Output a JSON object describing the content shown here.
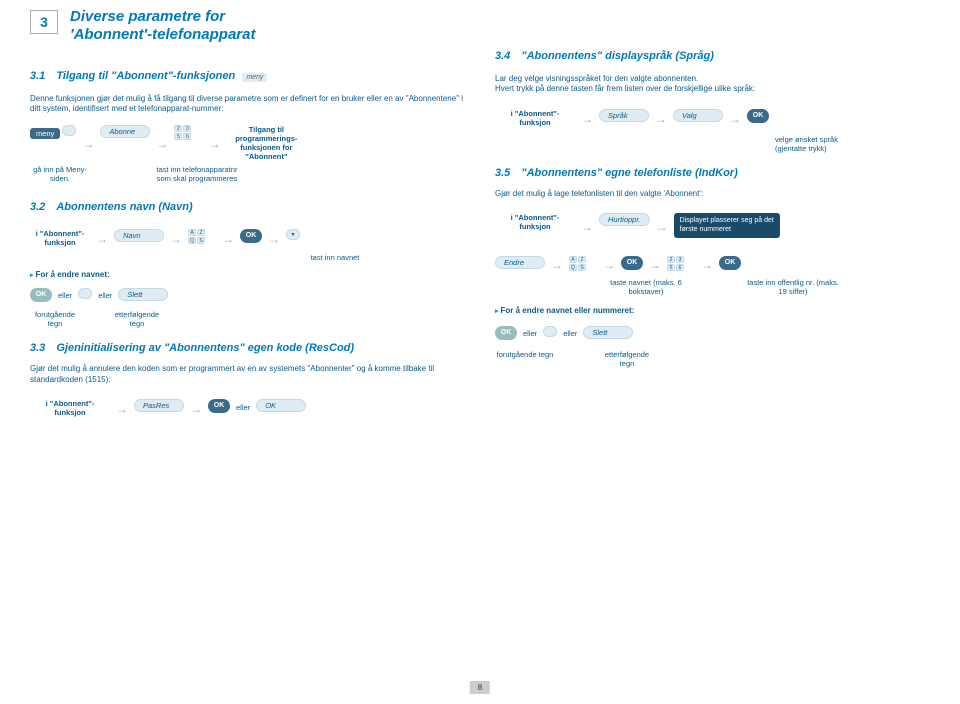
{
  "page_number": "3",
  "page_title_line1": "Diverse parametre for",
  "page_title_line2": "'Abonnent'-telefonapparat",
  "sec31": {
    "num": "3.1",
    "title": "Tilgang til \"Abonnent\"-funksjonen",
    "tag": "meny",
    "intro": "Denne funksjonen gjør det mulig å få tilgang til diverse parametre som er definert for en bruker eller en av \"Abonnentene\" i ditt system, identifisert med et telefonapparat-nummer:",
    "meny_label": "meny",
    "abonne_pill": "Abonne",
    "cap1": "gå inn på Meny-siden.",
    "cap2": "tast inn telefonapparatnr som skal programmeres",
    "cap3": "Tilgang til programmerings-funksjonen for \"Abonnent\""
  },
  "sec32": {
    "num": "3.2",
    "title": "Abonnentens navn (Navn)",
    "abonnent_func": "i \"Abonnent\"-funksjon",
    "navn_pill": "Navn",
    "ok": "OK",
    "cap_tast": "tast inn navnet",
    "endre": "For å endre navnet:",
    "eller": "eller",
    "slett_pill": "Slett",
    "cap_forut": "forutgående tegn",
    "cap_etter": "etterfølgende tegn"
  },
  "sec33": {
    "num": "3.3",
    "title": "Gjeninitialisering av \"Abonnentens\" egen kode (ResCod)",
    "intro": "Gjør det mulig å annulere den koden som er programmert av en av systemets \"Abonnenter\" og å komme tilbake til standardkoden (1515):",
    "abonnent_func": "i \"Abonnent\"-funksjon",
    "pasres_pill": "PasRes",
    "ok": "OK",
    "eller": "eller",
    "ok_pill": "OK"
  },
  "sec34": {
    "num": "3.4",
    "title": "\"Abonnentens\" displayspråk (Språg)",
    "line1": "Lar deg velge visningsspråket for den valgte abonnenten.",
    "line2": "Hvert trykk på denne tasten får frem listen over de forskjellige ulike språk:",
    "abonnent_func": "i \"Abonnent\"-funksjon",
    "sprak_pill": "Språk",
    "valg_pill": "Valg",
    "ok": "OK",
    "cap_velge": "velge ønsket språk (gjentatte trykk)"
  },
  "sec35": {
    "num": "3.5",
    "title": "\"Abonnentens\" egne telefonliste (IndKor)",
    "intro": "Gjør det mulig å lage telefonlisten til den valgte 'Abonnent':",
    "abonnent_func": "i \"Abonnent\"-funksjon",
    "hurti_pill": "Hurtioppr.",
    "display_line1": "Displayet plasserer seg på det",
    "display_line2": "første nummeret",
    "endre_pill": "Endre",
    "ok": "OK",
    "cap_navn": "taste navnet (maks. 6 bokstaver)",
    "cap_nr": "taste inn offentlig nr. (maks. 19 siffer)",
    "endre_nr": "For å endre navnet eller nummeret:",
    "eller": "eller",
    "slett_pill": "Slett",
    "cap_forut": "forutgående tegn",
    "cap_etter": "etterfølgende tegn"
  },
  "footer_page": "8"
}
